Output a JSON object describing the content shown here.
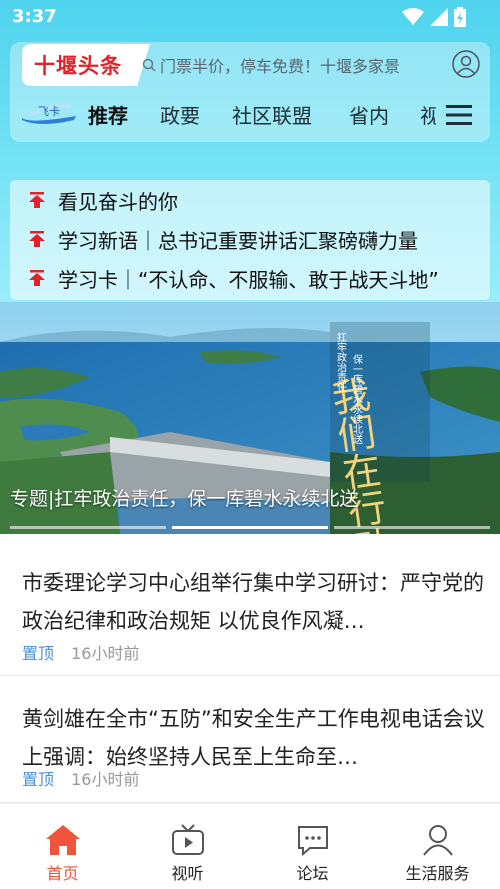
{
  "status": {
    "time": "3:37"
  },
  "header": {
    "logo_text": "十堰头条",
    "search_placeholder": "门票半价，停车免费！十堰多家景"
  },
  "tabs": [
    {
      "label": "推荐"
    },
    {
      "label": "政要"
    },
    {
      "label": "社区联盟"
    },
    {
      "label": "省内"
    },
    {
      "label": "视"
    }
  ],
  "tab_logo_text": "飞卡",
  "headlines": [
    {
      "text": "看见奋斗的你"
    },
    {
      "text": "学习新语｜总书记重要讲话汇聚磅礴力量"
    },
    {
      "text": "学习卡｜“不认命、不服输、敢于战天斗地”"
    }
  ],
  "banner": {
    "caption": "专题|扛牢政治责任，保一库碧水永续北送",
    "calligraphy": "我们在行动",
    "vertical_text_1": "扛牢政治责任",
    "vertical_text_2": "保一库碧水永续北送"
  },
  "articles": [
    {
      "title": "市委理论学习中心组举行集中学习研讨：严守党的政治纪律和政治规矩 以优良作风凝…",
      "pin": "置顶",
      "time": "16小时前"
    },
    {
      "title": "黄剑雄在全市“五防”和安全生产工作电视电话会议上强调：始终坚持人民至上生命至…",
      "pin": "置顶",
      "time": "16小时前"
    }
  ],
  "bottom_nav": [
    {
      "label": "首页",
      "icon": "home-icon",
      "active": true
    },
    {
      "label": "视听",
      "icon": "tv-icon",
      "active": false
    },
    {
      "label": "论坛",
      "icon": "chat-icon",
      "active": false
    },
    {
      "label": "生活服务",
      "icon": "person-icon",
      "active": false
    }
  ],
  "colors": {
    "accent": "#f0543c",
    "logo_red": "#e0232b",
    "pin_blue": "#4a90d9",
    "sky": "#4fd3ee"
  }
}
